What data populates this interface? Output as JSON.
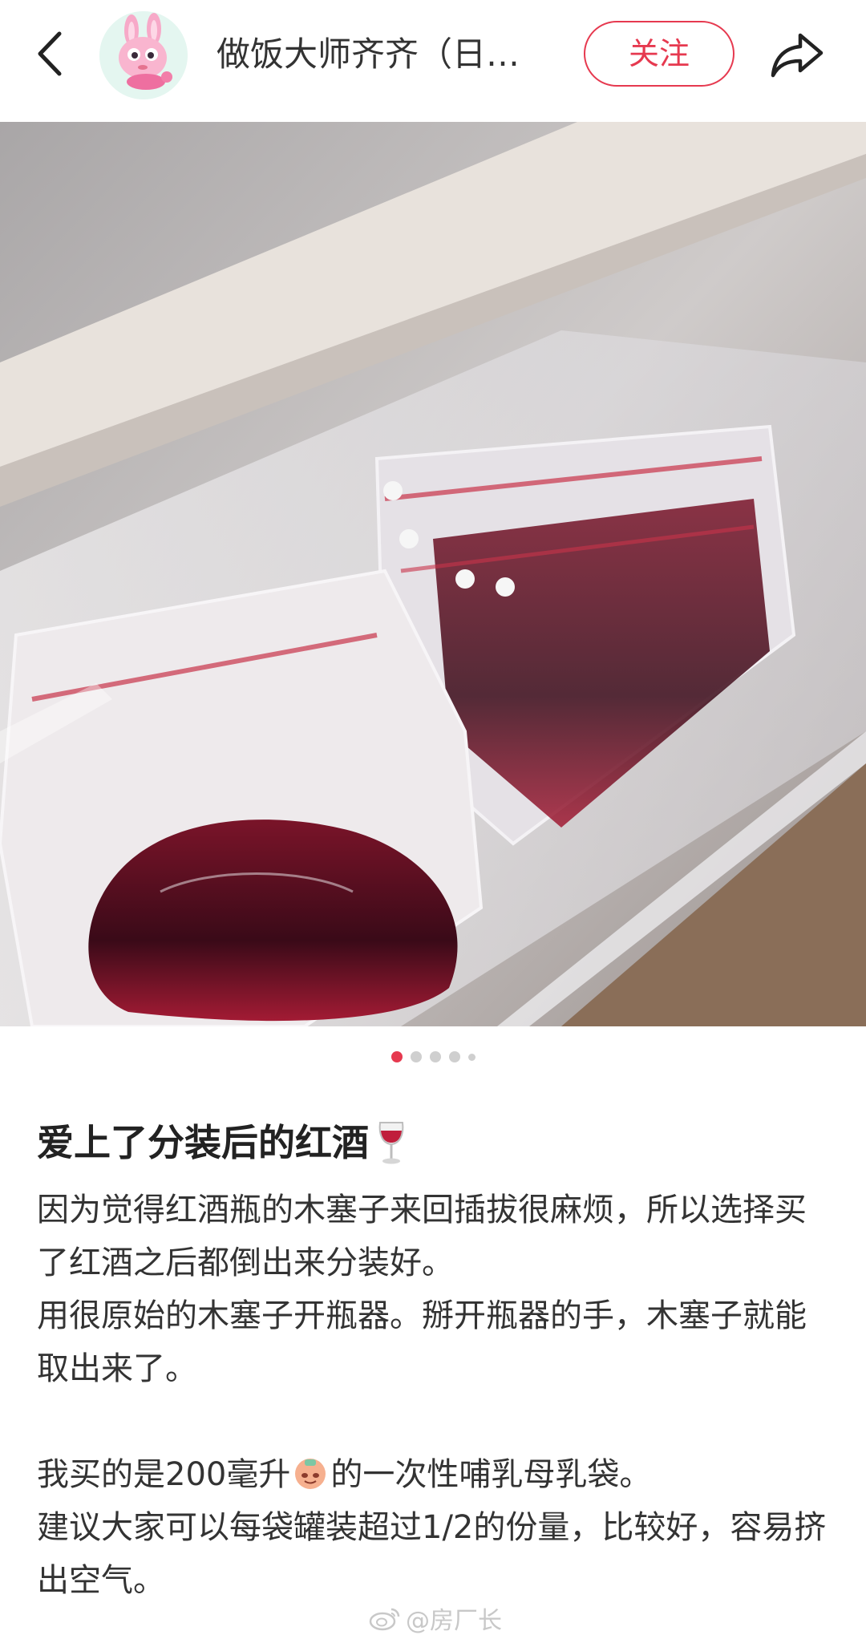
{
  "header": {
    "back_icon": "chevron-left-icon",
    "author_name": "做饭大师齐齐（日…",
    "follow_label": "关注",
    "share_icon": "share-arrow-icon",
    "follow_color": "#e6394f"
  },
  "carousel": {
    "total_indicators": 5,
    "active_index": 1,
    "active_color": "#e6394f"
  },
  "post": {
    "title": "爱上了分装后的红酒",
    "title_emoji": "wine-glass-icon",
    "paragraphs": [
      "因为觉得红酒瓶的木塞子来回插拔很麻烦，所以选择买了红酒之后都倒出来分装好。",
      "用很原始的木塞子开瓶器。掰开瓶器的手，木塞子就能取出来了。",
      "",
      "我买的是200毫升",
      "的一次性哺乳母乳袋。",
      "建议大家可以每袋罐装超过1/2的份量，比较好，容易挤出空气。"
    ]
  },
  "watermark": {
    "icon": "weibo-icon",
    "text": "@房厂长"
  }
}
